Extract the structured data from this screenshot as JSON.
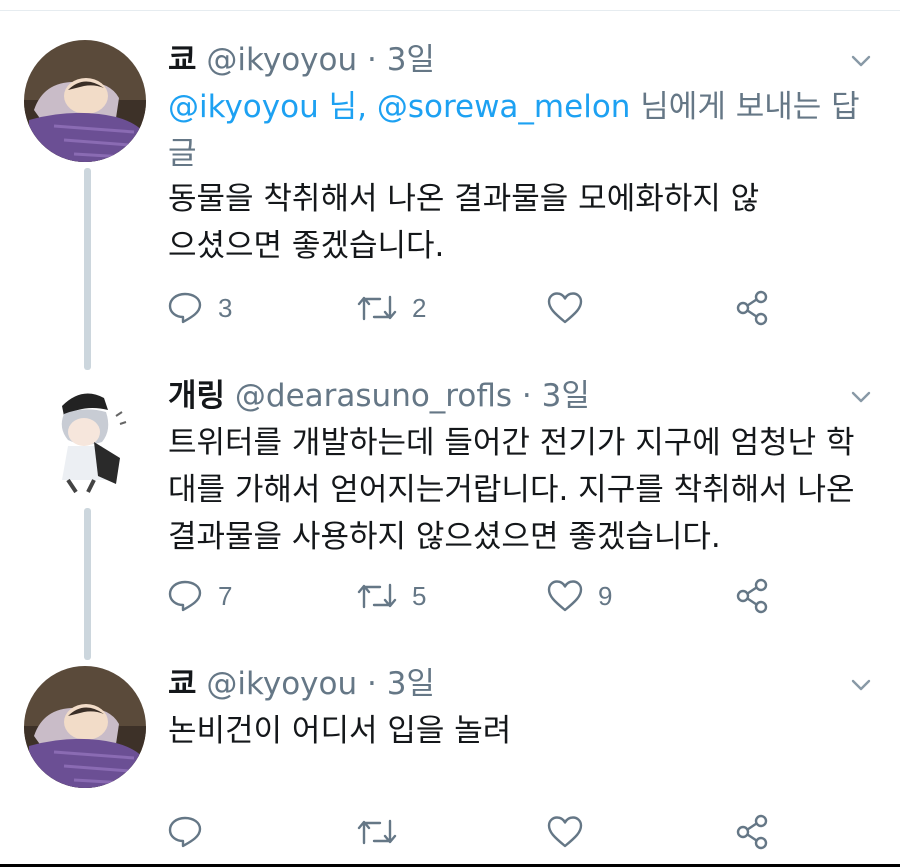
{
  "tweets": [
    {
      "name": "쿄",
      "handle": "@ikyoyou",
      "dot": "·",
      "time": "3일",
      "reply_mention_1": "@ikyoyou 님,",
      "reply_mention_2": "@sorewa_melon",
      "reply_suffix": " 님에게 보내는 답글",
      "text": "동물을 착취해서 나온 결과물을 모에화하지 않으셨으면 좋겠습니다.",
      "replies": "3",
      "retweets": "2",
      "likes": ""
    },
    {
      "name": "개링",
      "handle": "@dearasuno_rofls",
      "dot": "·",
      "time": "3일",
      "text": "트위터를 개발하는데 들어간 전기가 지구에 엄청난 학대를 가해서 얻어지는거랍니다. 지구를 착취해서 나온 결과물을 사용하지 않으셨으면 좋겠습니다.",
      "replies": "7",
      "retweets": "5",
      "likes": "9"
    },
    {
      "name": "쿄",
      "handle": "@ikyoyou",
      "dot": "·",
      "time": "3일",
      "text": "논비건이 어디서 입을 놀려",
      "replies": "",
      "retweets": "",
      "likes": ""
    }
  ],
  "icons": [
    "reply-icon",
    "retweet-icon",
    "like-icon",
    "share-icon",
    "chevron-down-icon"
  ],
  "colors": {
    "text": "#14171a",
    "secondary": "#657786",
    "link": "#1da1f2",
    "thread": "#ccd6dd"
  }
}
